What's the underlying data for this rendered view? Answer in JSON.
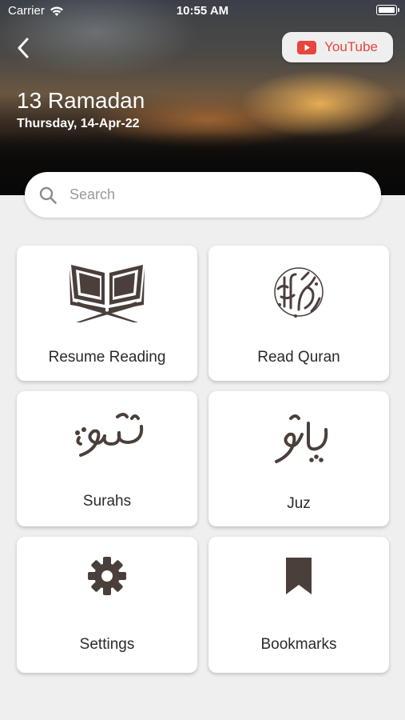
{
  "status_bar": {
    "carrier": "Carrier",
    "time": "10:55 AM"
  },
  "header": {
    "hijri_date": "13 Ramadan",
    "gregorian_date": "Thursday, 14-Apr-22",
    "youtube_label": "YouTube"
  },
  "search": {
    "placeholder": "Search"
  },
  "tiles": [
    {
      "label": "Resume Reading",
      "icon": "open-book-on-stand-icon"
    },
    {
      "label": "Read Quran",
      "icon": "quran-calligraphy-icon"
    },
    {
      "label": "Surahs",
      "icon": "surah-calligraphy-icon"
    },
    {
      "label": "Juz",
      "icon": "para-calligraphy-icon"
    },
    {
      "label": "Settings",
      "icon": "gear-icon"
    },
    {
      "label": "Bookmarks",
      "icon": "bookmark-icon"
    }
  ],
  "colors": {
    "icon": "#4a3f3b",
    "youtube_red": "#e8453c",
    "background": "#efefef"
  }
}
